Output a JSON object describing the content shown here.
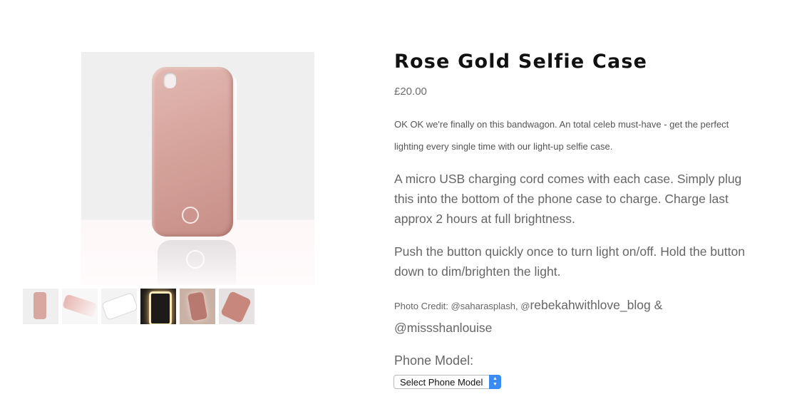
{
  "product": {
    "title": "Rose Gold Selfie Case",
    "price": "£20.00",
    "intro": "OK OK we're finally on this bandwagon. An total celeb must-have - get the perfect lighting every single time with our light-up selfie case.",
    "paragraphs": [
      "A micro USB charging cord comes with each case. Simply plug this into the bottom of the phone case to charge. Charge last approx 2 hours at full brightness.",
      "Push the button quickly once to turn light on/off. Hold the button down to dim/brighten the light."
    ],
    "credit": {
      "prefix": "Photo Credit: @saharasplash, @",
      "handles": "rebekahwithlove_blog & @missshanlouise"
    }
  },
  "variant": {
    "label": "Phone Model:",
    "selected": "Select Phone Model"
  },
  "gallery": {
    "thumbnails": [
      "thumbnail-1",
      "thumbnail-2",
      "thumbnail-3",
      "thumbnail-4",
      "thumbnail-5",
      "thumbnail-6"
    ]
  },
  "icons": {
    "select_arrows": "updown-chevron-icon"
  },
  "colors": {
    "rose_gold": "#d6a49c",
    "select_accent": "#3a8cf3",
    "title": "#111111"
  }
}
